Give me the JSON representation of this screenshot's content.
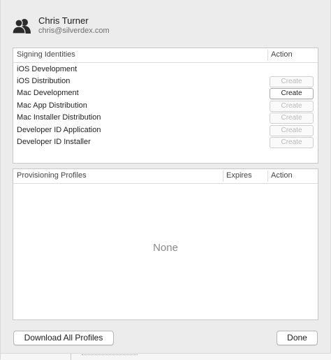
{
  "account": {
    "name": "Chris Turner",
    "email": "chris@silverdex.com",
    "avatar_icon": "people-icon"
  },
  "signing": {
    "header_label": "Signing Identities",
    "action_header": "Action",
    "rows": [
      {
        "label": "iOS Development",
        "button": "",
        "enabled": false
      },
      {
        "label": "iOS Distribution",
        "button": "Create",
        "enabled": false
      },
      {
        "label": "Mac Development",
        "button": "Create",
        "enabled": true
      },
      {
        "label": "Mac App Distribution",
        "button": "Create",
        "enabled": false
      },
      {
        "label": "Mac Installer Distribution",
        "button": "Create",
        "enabled": false
      },
      {
        "label": "Developer ID Application",
        "button": "Create",
        "enabled": false
      },
      {
        "label": "Developer ID Installer",
        "button": "Create",
        "enabled": false
      }
    ]
  },
  "profiles": {
    "header_label": "Provisioning Profiles",
    "expires_header": "Expires",
    "action_header": "Action",
    "empty_text": "None"
  },
  "buttons": {
    "download_all": "Download All Profiles",
    "done": "Done"
  }
}
